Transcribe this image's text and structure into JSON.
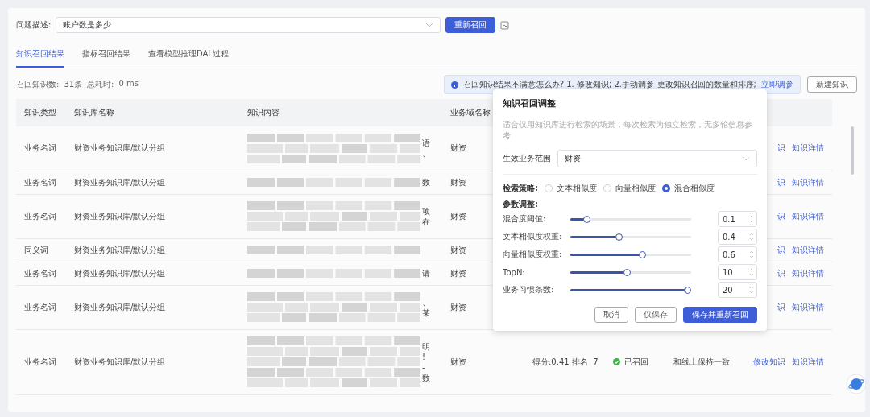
{
  "query": {
    "label": "问题描述:",
    "value": "账户数是多少"
  },
  "requery_button": "重新召回",
  "tabs": [
    {
      "label": "知识召回结果",
      "selected": true
    },
    {
      "label": "指标召回结果",
      "selected": false
    },
    {
      "label": "查看模型推理DAL过程",
      "selected": false
    }
  ],
  "stats": {
    "count_label": "召回知识数:",
    "count": "31条",
    "time_label": "总耗时:",
    "time": "0 ms"
  },
  "notice": {
    "text": "召回知识结果不满意怎么办? 1. 修改知识; 2.手动调参-更改知识召回的数量和排序;",
    "link": "立即调参"
  },
  "new_button": "新建知识",
  "table": {
    "columns": [
      "知识类型",
      "知识库名称",
      "知识内容",
      "业务域名称"
    ],
    "rows": [
      {
        "type": "业务名词",
        "library": "财资业务知识库/默认分组",
        "content_tail": [
          "语",
          "、"
        ],
        "domain": "财资",
        "edit_link": "识",
        "detail_link": "知识详情"
      },
      {
        "type": "业务名词",
        "library": "财资业务知识库/默认分组",
        "content_tail": [
          "数"
        ],
        "domain": "财资",
        "edit_link": "识",
        "detail_link": "知识详情"
      },
      {
        "type": "业务名词",
        "library": "财资业务知识库/默认分组",
        "content_tail": [
          "项",
          "在"
        ],
        "domain": "财资",
        "edit_link": "识",
        "detail_link": "知识详情"
      },
      {
        "type": "同义词",
        "library": "财资业务知识库/默认分组",
        "content_tail": [],
        "domain": "财资",
        "edit_link": "识",
        "detail_link": "知识详情"
      },
      {
        "type": "业务名词",
        "library": "财资业务知识库/默认分组",
        "content_tail": [
          "请"
        ],
        "domain": "财资",
        "edit_link": "识",
        "detail_link": "知识详情"
      },
      {
        "type": "业务名词",
        "library": "财资业务知识库/默认分组",
        "content_tail": [
          "、",
          "某"
        ],
        "domain": "财资",
        "edit_link": "识",
        "detail_link": "知识详情"
      },
      {
        "type": "业务名词",
        "library": "财资业务知识库/默认分组",
        "content_tail": [
          "明",
          "!",
          "-",
          "数"
        ],
        "domain": "财资",
        "score": "得分:0.41 排名  7",
        "status": {
          "text": "已召回",
          "recalled": true
        },
        "note": "和线上保持一致",
        "edit_link": "修改知识",
        "detail_link": "知识详情"
      }
    ]
  },
  "popup": {
    "title": "知识召回调整",
    "description": "适合仅用知识库进行检索的场景，每次检索为独立检索，无多轮信息参考",
    "scope": {
      "label": "生效业务范围",
      "value": "财资"
    },
    "strategy": {
      "label": "检索策略:",
      "options": [
        {
          "label": "文本相似度",
          "selected": false
        },
        {
          "label": "向量相似度",
          "selected": false
        },
        {
          "label": "混合相似度",
          "selected": true
        }
      ]
    },
    "params_label": "参数调整:",
    "params": [
      {
        "label": "混合度阈值:",
        "level": 0.11,
        "value": "0.1"
      },
      {
        "label": "文本相似度权重:",
        "level": 0.4,
        "value": "0.4"
      },
      {
        "label": "向量相似度权重:",
        "level": 0.6,
        "value": "0.6"
      },
      {
        "label": "TopN:",
        "level": 0.47,
        "value": "10"
      },
      {
        "label": "业务习惯条数:",
        "level": 1,
        "value": "20"
      }
    ],
    "buttons": [
      {
        "label": "取消",
        "kind": "plain"
      },
      {
        "label": "仅保存",
        "kind": "plain"
      },
      {
        "label": "保存并重新召回",
        "kind": "primary"
      }
    ]
  }
}
